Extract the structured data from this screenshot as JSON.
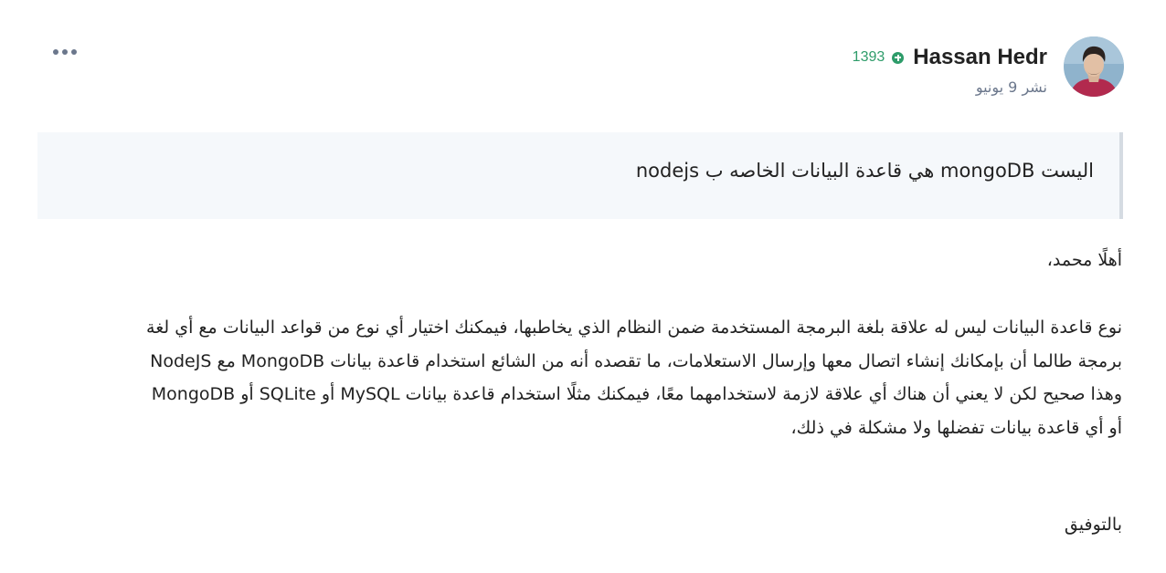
{
  "post": {
    "author_name": "Hassan Hedr",
    "reputation": "1393",
    "date": "نشر 9 يونيو",
    "more_icon": "more-dots-icon",
    "reputation_icon": "plus-circle-icon",
    "quote": "اليست mongoDB هي قاعدة البيانات الخاصه ب nodejs",
    "greeting": "أهلًا محمد،",
    "paragraph_lines": [
      "نوع قاعدة البيانات ليس له علاقة بلغة البرمجة المستخدمة ضمن النظام الذي يخاطبها، فيمكنك اختيار أي نوع من قواعد البيانات مع أي لغة",
      "برمجة طالما أن بإمكانك إنشاء اتصال معها وإرسال الاستعلامات، ما تقصده أنه من الشائع استخدام قاعدة بيانات MongoDB مع NodeJS",
      "وهذا صحيح لكن لا يعني أن هناك أي علاقة لازمة لاستخدامهما معًا، فيمكنك مثلًا استخدام قاعدة بيانات MySQL أو SQLite أو MongoDB",
      "أو أي قاعدة بيانات تفضلها ولا مشكلة في ذلك،"
    ],
    "signoff": "بالتوفيق"
  },
  "colors": {
    "text": "#222222",
    "muted": "#6b778c",
    "reputation_green": "#2e9c6a",
    "quote_background": "#f5f8fb",
    "quote_border": "#d5dbe2"
  }
}
